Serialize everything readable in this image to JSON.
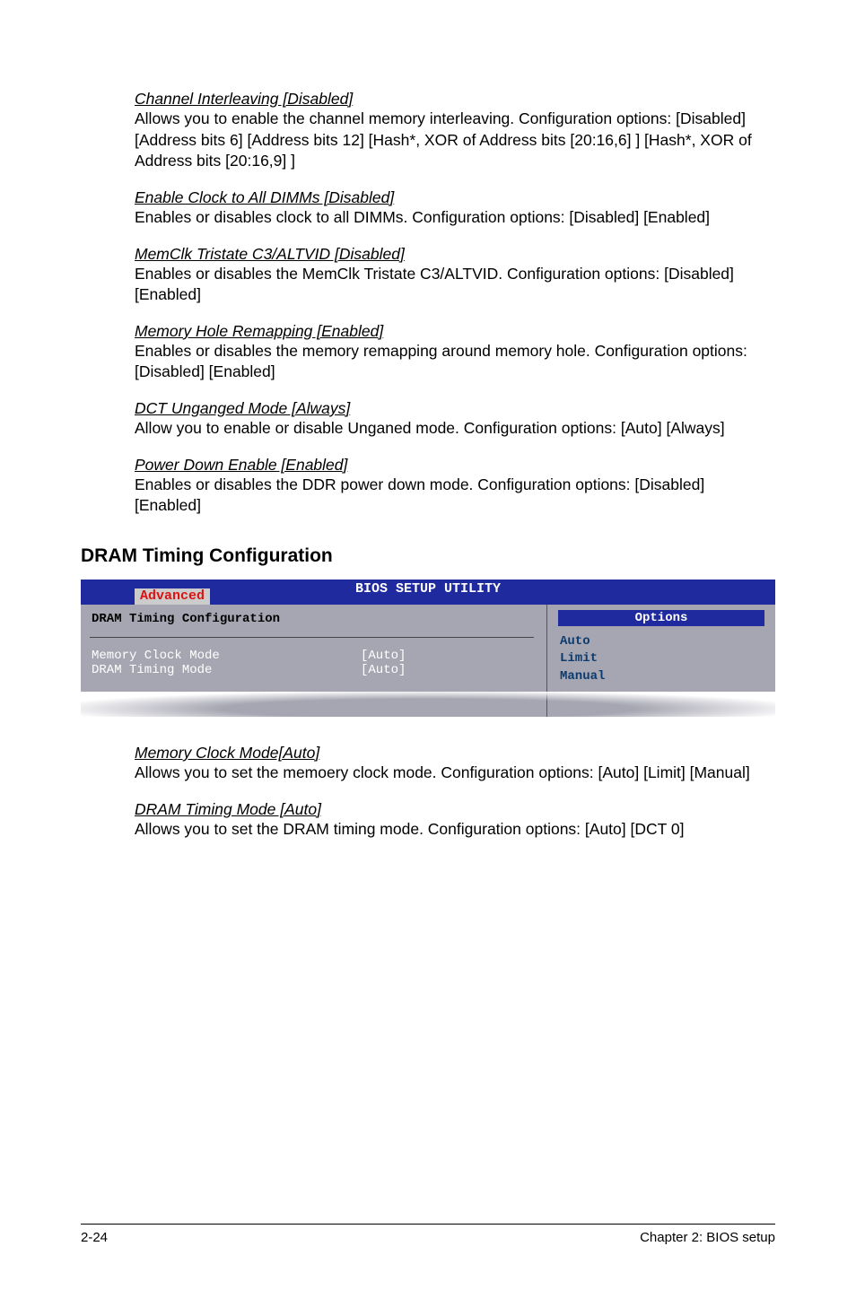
{
  "sections": {
    "channel_interleaving": {
      "title": "Channel Interleaving [Disabled]",
      "body": "Allows you to enable the channel memory interleaving. Configuration options: [Disabled] [Address bits 6] [Address bits 12] [Hash*, XOR of Address bits [20:16,6] ] [Hash*, XOR of Address bits [20:16,9] ]"
    },
    "enable_clock": {
      "title": "Enable Clock to All DIMMs [Disabled]",
      "body": "Enables or disables clock to all DIMMs. Configuration options: [Disabled] [Enabled]"
    },
    "memclk_tristate": {
      "title": "MemClk Tristate C3/ALTVID [Disabled]",
      "body": "Enables or disables the MemClk Tristate C3/ALTVID. Configuration options: [Disabled] [Enabled]"
    },
    "memory_hole": {
      "title": "Memory Hole Remapping [Enabled]",
      "body": "Enables or disables the memory remapping around memory hole. Configuration options: [Disabled] [Enabled]"
    },
    "dct_unganged": {
      "title": "DCT Unganged Mode [Always]",
      "body": "Allow you to enable or disable Unganed mode. Configuration options: [Auto] [Always]"
    },
    "power_down": {
      "title": "Power Down Enable [Enabled]",
      "body": "Enables or disables the DDR power down mode. Configuration options: [Disabled] [Enabled]"
    },
    "memory_clock_mode": {
      "title": "Memory Clock Mode[Auto]",
      "body": "Allows you to set the memoery clock mode. Configuration options: [Auto] [Limit] [Manual]"
    },
    "dram_timing_mode": {
      "title": "DRAM Timing Mode [Auto]",
      "body": "Allows you to set the DRAM timing mode. Configuration options: [Auto] [DCT 0]"
    }
  },
  "heading": "DRAM Timing Configuration",
  "bios": {
    "header": "BIOS SETUP UTILITY",
    "tab": "Advanced",
    "panel_title": "DRAM Timing Configuration",
    "rows": [
      {
        "label": "Memory Clock Mode",
        "value": "[Auto]"
      },
      {
        "label": "DRAM Timing Mode",
        "value": "[Auto]"
      }
    ],
    "options_header": "Options",
    "options": [
      "Auto",
      "Limit",
      "Manual"
    ]
  },
  "footer": {
    "left": "2-24",
    "right": "Chapter 2: BIOS setup"
  }
}
